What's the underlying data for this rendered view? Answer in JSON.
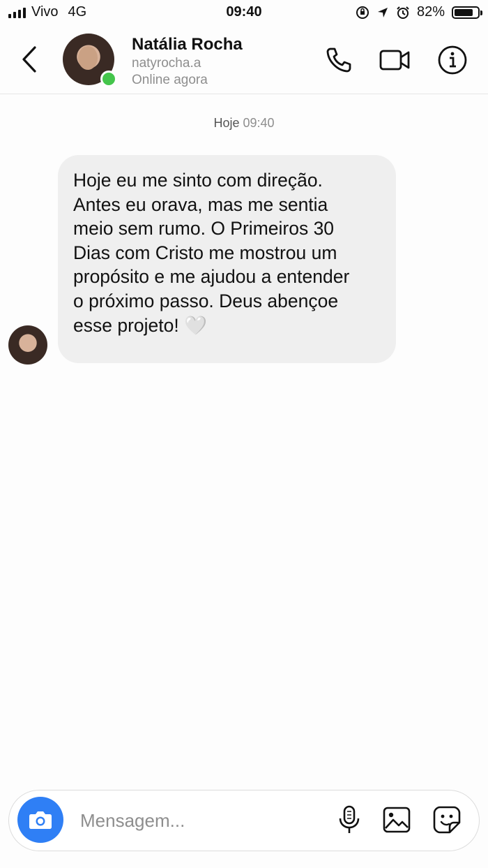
{
  "status_bar": {
    "carrier": "Vivo",
    "network": "4G",
    "time": "09:40",
    "battery": "82%",
    "battery_level": 0.82
  },
  "header": {
    "name": "Natália Rocha",
    "username": "natyrocha.a",
    "status": "Online agora",
    "icons": [
      "back-icon",
      "phone-icon",
      "video-icon",
      "info-icon"
    ]
  },
  "conversation": {
    "day": "Hoje",
    "time": "09:40",
    "messages": [
      {
        "text": "Hoje eu me sinto com direção.\nAntes eu orava, mas me sentia\nmeio sem rumo. O Primeiros 30\nDias com Cristo me mostrou um\npropósito e me ajudou a entender\no próximo passo. Deus abençoe\nesse projeto! 🤍"
      }
    ]
  },
  "composer": {
    "placeholder": "Mensagem...",
    "value": "",
    "icons": [
      "camera-icon",
      "microphone-icon",
      "gallery-icon",
      "sticker-icon"
    ]
  },
  "colors": {
    "accent": "#2f7ff5",
    "online": "#44c54b",
    "bubble": "#efefef",
    "secondary_text": "#8e8e8e"
  }
}
